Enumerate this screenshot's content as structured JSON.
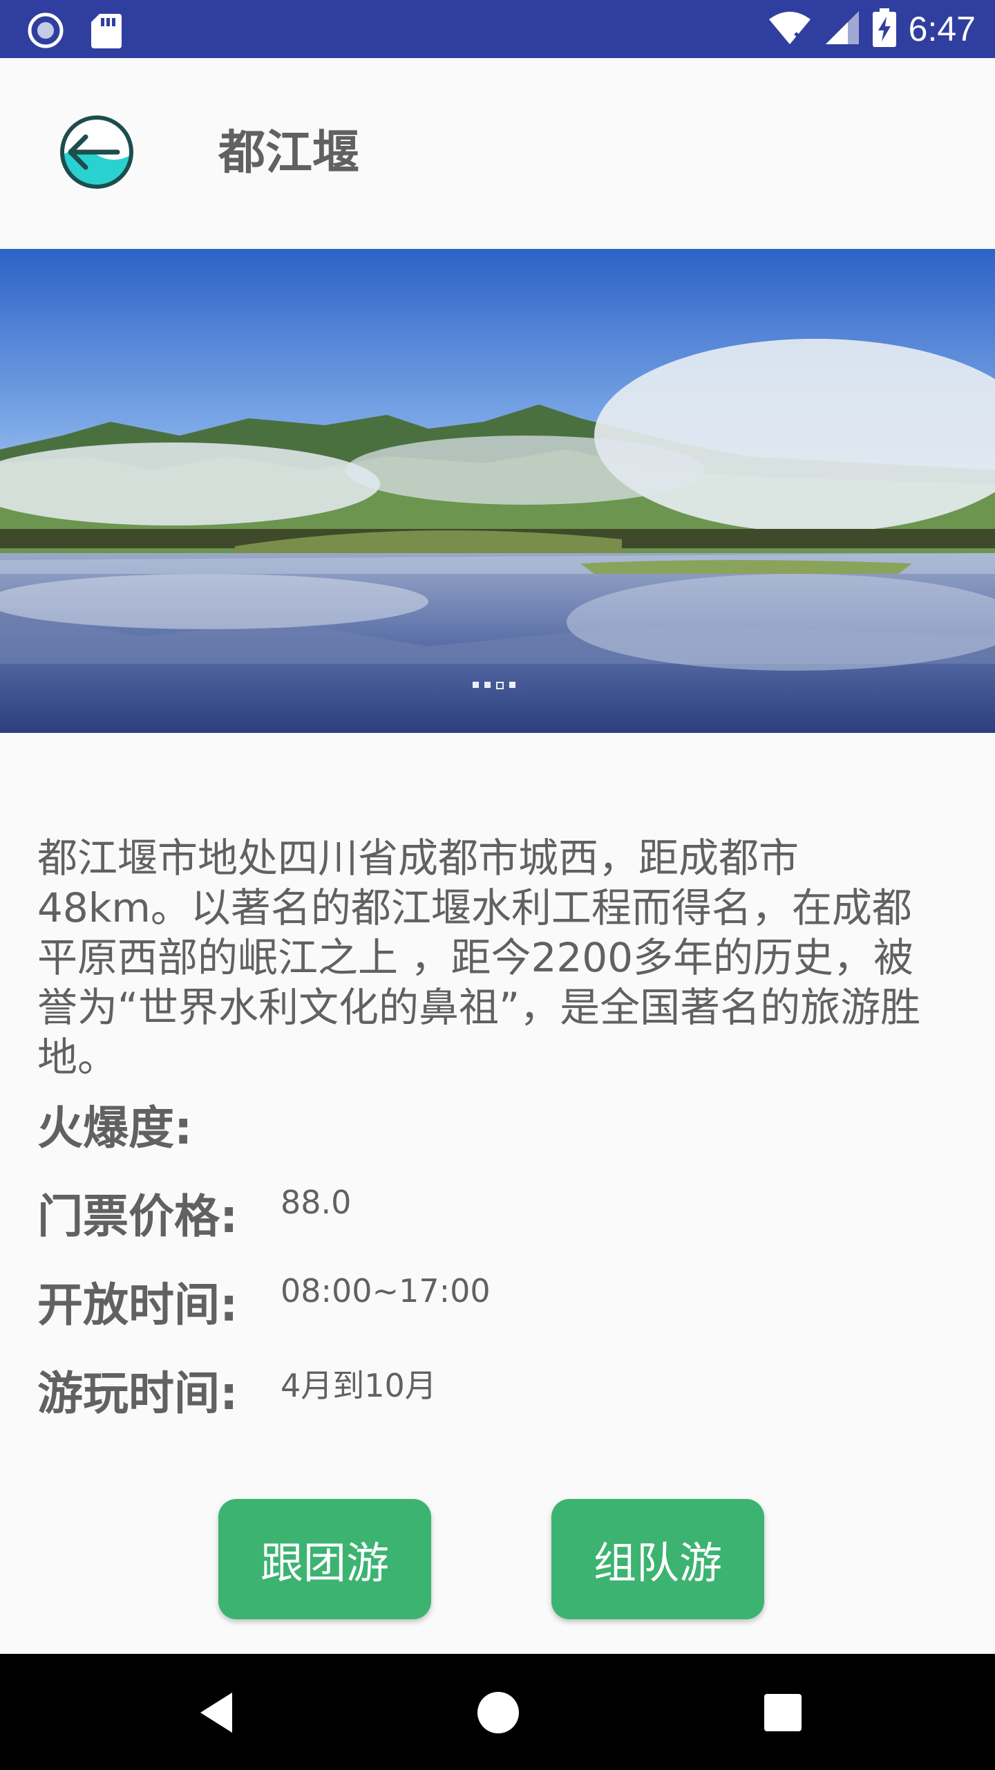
{
  "status_bar": {
    "time": "6:47",
    "icons": [
      "radio-icon",
      "sd-card-icon",
      "wifi-icon",
      "signal-icon",
      "battery-charging-icon"
    ],
    "color": "#303f9f"
  },
  "header": {
    "title": "都江堰",
    "back_icon": "back-arrow-icon"
  },
  "banner": {
    "image": "mountain-lake-landscape",
    "dots_count": 4,
    "active_dot": 2
  },
  "description": "都江堰市地处四川省成都市城西，距成都市48km。以著名的都江堰水利工程而得名，在成都平原西部的岷江之上 ，距今2200多年的历史，被誉为“世界水利文化的鼻祖”，是全国著名的旅游胜地。",
  "info": {
    "popularity_label": "火爆度:",
    "price_label": "门票价格:",
    "price_value": "88.0",
    "hours_label": "开放时间:",
    "hours_value": "08:00~17:00",
    "season_label": "游玩时间:",
    "season_value": "4月到10月"
  },
  "buttons": {
    "group_tour": "跟团游",
    "team_tour": "组队游",
    "color": "#3cb371"
  },
  "nav_bar": {
    "icons": [
      "back-triangle-icon",
      "home-circle-icon",
      "recents-square-icon"
    ]
  }
}
